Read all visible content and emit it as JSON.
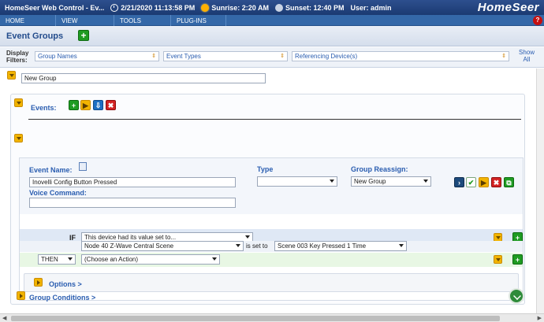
{
  "header": {
    "title": "HomeSeer Web Control - Ev...",
    "datetime": "2/21/2020 11:13:58 PM",
    "sunrise": "Sunrise: 2:20 AM",
    "sunset": "Sunset: 12:40 PM",
    "user": "User: admin",
    "brand": "HomeSeer"
  },
  "nav": {
    "items": [
      {
        "label": "HOME"
      },
      {
        "label": "VIEW"
      },
      {
        "label": "TOOLS"
      },
      {
        "label": "PLUG-INS"
      }
    ]
  },
  "page": {
    "title": "Event Groups"
  },
  "filters": {
    "label_line1": "Display",
    "label_line2": "Filters:",
    "group_names": "Group Names",
    "event_types": "Event Types",
    "referencing_devices": "Referencing Device(s)",
    "show_all_line1": "Show",
    "show_all_line2": "All"
  },
  "group": {
    "name_value": "New Group",
    "events_label": "Events:",
    "conditions_label": "Group Conditions >"
  },
  "event": {
    "name_label": "Event Name:",
    "name_value": "Inovelli Config Button Pressed",
    "voice_label": "Voice Command:",
    "voice_value": "",
    "type_label": "Type",
    "type_value": "",
    "reassign_label": "Group Reassign:",
    "reassign_value": "New Group",
    "if_label": "IF",
    "if_condition": "This device had its value set to...",
    "if_device": "Node 40 Z-Wave Central Scene",
    "is_set_to": "is set to",
    "if_value": "Scene 003 Key Pressed 1 Time",
    "then_label": "THEN",
    "then_action": "(Choose an Action)",
    "options_label": "Options >"
  },
  "colors": {
    "header_bg": "#1b3a72",
    "nav_bg": "#3468a8",
    "link": "#2a5db0",
    "if_row": "#dfe8f5",
    "then_row": "#e8f7e4"
  }
}
